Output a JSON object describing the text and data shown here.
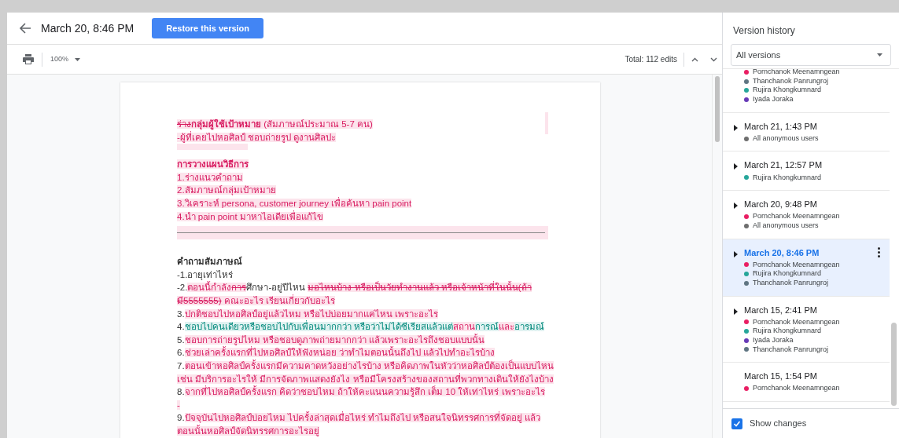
{
  "header": {
    "title": "March 20, 8:46 PM",
    "restore_button": "Restore this version"
  },
  "toolbar": {
    "zoom": "100%",
    "total_edits": "Total: 112 edits"
  },
  "document": {
    "paragraphs": [
      {
        "kind": "text",
        "segments": [
          {
            "text": "ร่าง",
            "kind": "deleted"
          },
          {
            "text": "กลุ่มผู้ใช้เป้าหมาย",
            "kind": "inserted-bold"
          },
          {
            "text": " (สัมภาษณ์ประมาณ 5-7  คน)",
            "kind": "inserted"
          }
        ]
      },
      {
        "kind": "text",
        "segments": [
          {
            "text": " -ผู้ที่เคยไปหอศิลป์ ชอบถ่ายรูป ดูงานศิลปะ",
            "kind": "inserted"
          }
        ]
      },
      {
        "kind": "blank"
      },
      {
        "kind": "text",
        "segments": [
          {
            "text": "การวางแผนวิธีการ ",
            "kind": "inserted-bold"
          }
        ]
      },
      {
        "kind": "text",
        "segments": [
          {
            "text": "1.ร่างแนวคำถาม",
            "kind": "inserted"
          }
        ]
      },
      {
        "kind": "text",
        "segments": [
          {
            "text": "2.สัมภาษณ์กลุ่มเป้าหมาย",
            "kind": "inserted"
          }
        ]
      },
      {
        "kind": "text",
        "segments": [
          {
            "text": "3.วิเคราะห์ persona, customer journey เพื่อค้นหา pain point ",
            "kind": "inserted"
          }
        ]
      },
      {
        "kind": "text",
        "segments": [
          {
            "text": "4.นำ pain point มาหาไอเดียเพื่อแก้ไข",
            "kind": "inserted"
          }
        ]
      },
      {
        "kind": "rule"
      },
      {
        "kind": "text",
        "segments": [
          {
            "text": "คำถามสัมภาษณ์",
            "kind": "plain-bold"
          }
        ]
      },
      {
        "kind": "text",
        "segments": [
          {
            "text": "-1.อายุเท่าไหร่",
            "kind": "plain"
          }
        ]
      },
      {
        "kind": "text",
        "segments": [
          {
            "text": "-2.",
            "kind": "plain"
          },
          {
            "text": "ตอนนี้กำลัง",
            "kind": "inserted"
          },
          {
            "text": "การ",
            "kind": "deleted"
          },
          {
            "text": "ศึกษา-อยู่ปีไหน ",
            "kind": "plain"
          },
          {
            "text": "มอไหนบ้าง หรือเป็นวัยทำงานแล้ว หรือเจ้าหน้าที่ในนั้น(ถ้ามี5555555)",
            "kind": "deleted"
          },
          {
            "text": " คณะอะไร เรียนเกี่ยวกับอะไร",
            "kind": "inserted"
          }
        ]
      },
      {
        "kind": "text",
        "segments": [
          {
            "text": "3.",
            "kind": "plain"
          },
          {
            "text": "ปกติชอบไปหอศิลป์อยู่แล้วไหม หรือไปบ่อยมากแค่ไหน เพราะอะไร",
            "kind": "inserted"
          }
        ]
      },
      {
        "kind": "text",
        "segments": [
          {
            "text": "4.",
            "kind": "plain"
          },
          {
            "text": "ชอบไปคนเดียวหรือชอบไปกับเพื่อนมากกว่า หรือว่าไม่ได้ซีเรียสแล้วแต่",
            "kind": "inserted-alt"
          },
          {
            "text": "สถาน",
            "kind": "inserted"
          },
          {
            "text": "การณ์",
            "kind": "inserted-alt"
          },
          {
            "text": "และ",
            "kind": "inserted"
          },
          {
            "text": "อารมณ์",
            "kind": "inserted-alt"
          }
        ]
      },
      {
        "kind": "text",
        "segments": [
          {
            "text": "5.",
            "kind": "plain"
          },
          {
            "text": "ชอบการถ่ายรูปไหม หรือชอบดูภาพถ่ายมากกว่า แล้วเพราะอะไรถึงชอบแบบนั้น",
            "kind": "inserted"
          }
        ]
      },
      {
        "kind": "text",
        "segments": [
          {
            "text": "6.",
            "kind": "plain"
          },
          {
            "text": "ช่วยเล่าครั้งแรกที่ไปหอศิลป์ให้ฟังหน่อย ว่าทำไมตอนนั้นถึงไป แล้วไปทำอะไรบ้าง",
            "kind": "inserted"
          }
        ]
      },
      {
        "kind": "text",
        "segments": [
          {
            "text": "7.",
            "kind": "plain"
          },
          {
            "text": "ตอนเข้าหอศิลป์ครั้งแรกมีความคาดหวังอย่างไรบ้าง หรือคิดภาพในหัวว่าหอศิลป์ต้องเป็นแบบไหน เช่น มีบริการอะไรให้ มีการจัดภาพแสดงยังไง หรือมีโครงสร้างของสถานที่พวกทางเดินให้ยังไงบ้าง",
            "kind": "inserted"
          }
        ]
      },
      {
        "kind": "text",
        "segments": [
          {
            "text": "8.",
            "kind": "plain"
          },
          {
            "text": "จากที่ไปหอศิลป์ครั้งแรก คิดว่าชอบไหม ถ้าให้คะแนนความรู้สึก เต็ม 10 ให้เท่าไหร่ เพราะอะไร",
            "kind": "inserted"
          }
        ]
      },
      {
        "kind": "text",
        "segments": [
          {
            "text": "-",
            "kind": "inserted"
          }
        ]
      },
      {
        "kind": "text",
        "segments": [
          {
            "text": "9.",
            "kind": "plain"
          },
          {
            "text": "ปัจจุบันไปหอศิลป์บ่อยไหม ไปครั้งล่าสุดเมื่อไหร่ ทำไมถึงไป  หรือสนใจนิทรรศการที่จัดอยู่ แล้วตอนนั้นหอศิลป์จัดนิทรรศการอะไรอยู่",
            "kind": "inserted"
          }
        ]
      }
    ]
  },
  "panel": {
    "title": "Version history",
    "filter": "All versions",
    "versions": [
      {
        "expandable": false,
        "selected": false,
        "users": [
          {
            "name": "Pornchanok Meenamngean",
            "color": "#e91e63"
          },
          {
            "name": "Thanchanok Panrungroj",
            "color": "#5f7582"
          },
          {
            "name": "Rujira Khongkumnard",
            "color": "#26a69a"
          },
          {
            "name": "Iyada Joraka",
            "color": "#673ab7"
          }
        ]
      },
      {
        "date": "March 21, 1:43 PM",
        "expandable": true,
        "selected": false,
        "users": [
          {
            "name": "All anonymous users",
            "color": "#6e6e6e"
          }
        ]
      },
      {
        "date": "March 21, 12:57 PM",
        "expandable": true,
        "selected": false,
        "users": [
          {
            "name": "Rujira Khongkumnard",
            "color": "#26a69a"
          }
        ]
      },
      {
        "date": "March 20, 9:48 PM",
        "expandable": true,
        "selected": false,
        "users": [
          {
            "name": "Pornchanok Meenamngean",
            "color": "#e91e63"
          },
          {
            "name": "All anonymous users",
            "color": "#6e6e6e"
          }
        ]
      },
      {
        "date": "March 20, 8:46 PM",
        "expandable": true,
        "selected": true,
        "users": [
          {
            "name": "Pornchanok Meenamngean",
            "color": "#e91e63"
          },
          {
            "name": "Rujira Khongkumnard",
            "color": "#26a69a"
          },
          {
            "name": "Thanchanok Panrungroj",
            "color": "#5f7582"
          }
        ]
      },
      {
        "date": "March 15, 2:41 PM",
        "expandable": true,
        "selected": false,
        "users": [
          {
            "name": "Pornchanok Meenamngean",
            "color": "#e91e63"
          },
          {
            "name": "Rujira Khongkumnard",
            "color": "#26a69a"
          },
          {
            "name": "Iyada Joraka",
            "color": "#673ab7"
          },
          {
            "name": "Thanchanok Panrungroj",
            "color": "#5f7582"
          }
        ]
      },
      {
        "date": "March 15, 1:54 PM",
        "expandable": false,
        "selected": false,
        "users": [
          {
            "name": "Pornchanok Meenamngean",
            "color": "#e91e63"
          }
        ]
      }
    ],
    "show_changes": {
      "label": "Show changes",
      "checked": true
    }
  }
}
